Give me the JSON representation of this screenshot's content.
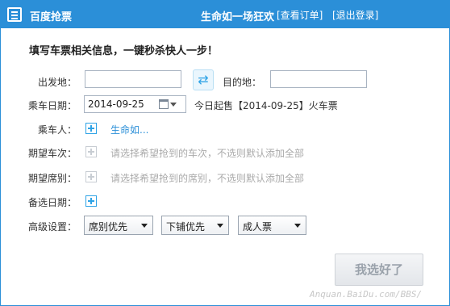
{
  "titlebar": {
    "app_icon": "ticket-icon",
    "app_title": "百度抢票",
    "slogan": "生命如一场狂欢",
    "orders_link": "[查看订单]",
    "logout_link": "[退出登录]",
    "background_color": "#2b8fd8"
  },
  "heading": "填写车票相关信息，一键秒杀快人一步！",
  "form": {
    "from_label": "出发地：",
    "from_value": "",
    "swap_icon": "swap-arrows-icon",
    "to_label": "目的地：",
    "to_value": "",
    "date_label": "乘车日期：",
    "date_value": "2014-09-25",
    "calendar_icon": "calendar-icon",
    "sale_note": "今日起售【2014-09-25】火车票",
    "passenger_label": "乘车人：",
    "passenger_name": "生命如...",
    "train_label": "期望车次：",
    "train_hint": "请选择希望抢到的车次，不选则默认添加全部",
    "seat_label": "期望席别：",
    "seat_hint": "请选择希望抢到的席别，不选则默认添加全部",
    "backup_date_label": "备选日期：",
    "advanced_label": "高级设置：",
    "priority_select": "席别优先",
    "berth_select": "下铺优先",
    "ticket_type_select": "成人票"
  },
  "submit_button": "我选好了",
  "watermark": "Anquan.BaiDu.com/BBS/",
  "accent_color": "#2fa3e6"
}
